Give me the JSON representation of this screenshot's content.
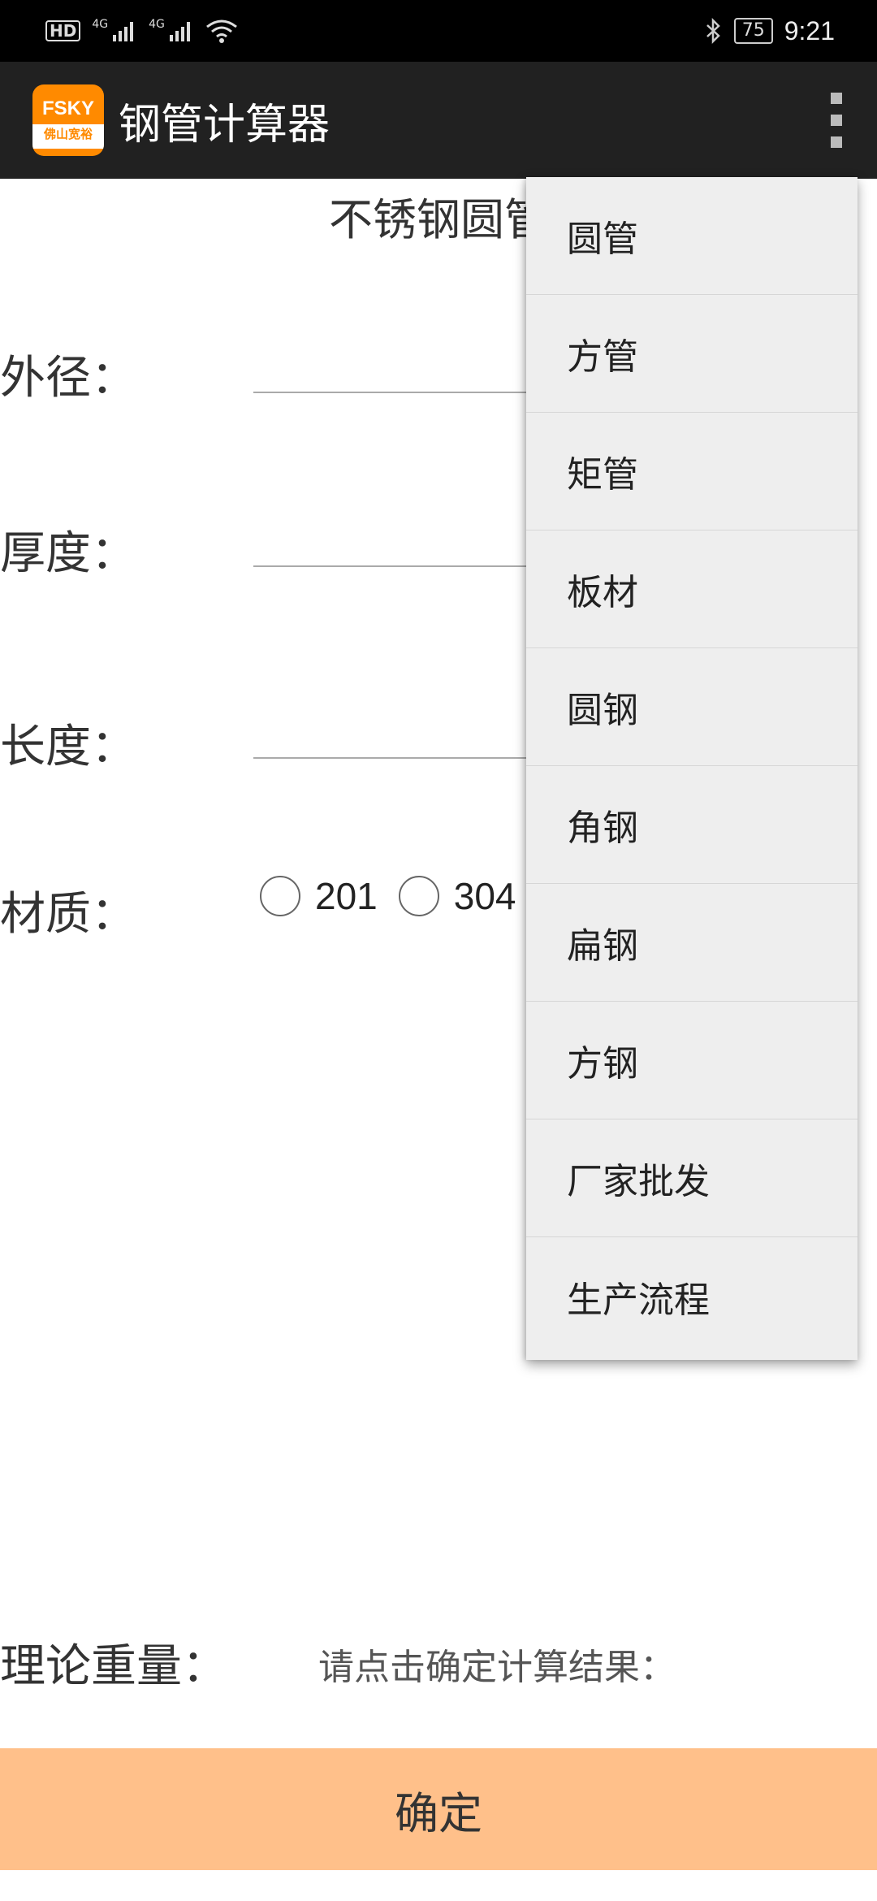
{
  "status_bar": {
    "left_badge": "HD",
    "network1": "4G",
    "network2": "4G",
    "battery": "75",
    "time": "9:21"
  },
  "app_bar": {
    "logo_top": "FSKY",
    "logo_bottom": "佛山宽裕",
    "title": "钢管计算器",
    "overflow_icon": "more-vert-icon"
  },
  "main": {
    "page_title": "不锈钢圆管",
    "fields": [
      {
        "label": "外径：",
        "value": ""
      },
      {
        "label": "厚度：",
        "value": ""
      },
      {
        "label": "长度：",
        "value": ""
      }
    ],
    "material": {
      "label": "材质：",
      "options": [
        "201",
        "304"
      ]
    },
    "result_label": "理论重量：",
    "result_text": "请点击确定计算结果：",
    "confirm_label": "确定"
  },
  "menu": {
    "items": [
      "圆管",
      "方管",
      "矩管",
      "板材",
      "圆钢",
      "角钢",
      "扁钢",
      "方钢",
      "厂家批发",
      "生产流程"
    ]
  },
  "colors": {
    "app_bar": "#212121",
    "confirm_button": "#ffc08a",
    "logo": "#ff8a00",
    "menu_bg": "#eeeeee"
  }
}
